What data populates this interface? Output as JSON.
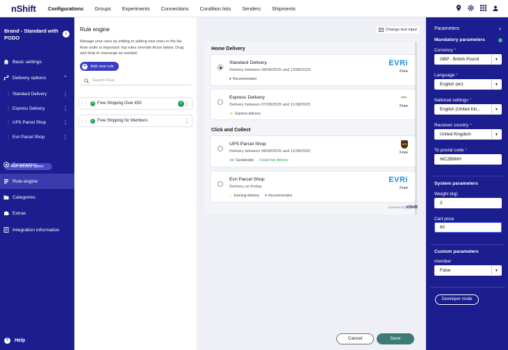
{
  "app": {
    "logo": "nShift",
    "nav": [
      "Configurations",
      "Groups",
      "Experiments",
      "Connections",
      "Condition lists",
      "Senders",
      "Shipments"
    ],
    "nav_active": "Configurations"
  },
  "sidebar": {
    "brand": "Brand - Standard with PODO",
    "items": {
      "basic_settings": "Basic settings",
      "delivery_options": "Delivery options",
      "parameters": "Parameters",
      "rule_engine": "Rule engine",
      "categories": "Categories",
      "extras": "Extras",
      "integration": "Integration information"
    },
    "delivery_sub": [
      "Standard Delivery",
      "Express Delivery",
      "UPS Parcel Shop",
      "Evri Parcel Shop"
    ],
    "add_delivery_option": "Add delivery option",
    "help": "Help"
  },
  "rules": {
    "title": "Rule engine",
    "description": "Manage your rules by editing or adding new ones to the list. Rule order is important: top rules override those below. Drag and drop to rearrange as needed.",
    "add_rule": "Add new rule",
    "search_placeholder": "Search Rule",
    "list": [
      "Free Shipping Over £50",
      "Free Shipping for Members"
    ]
  },
  "preview": {
    "change_test_input": "Change test input",
    "home_delivery": "Home Delivery",
    "click_collect": "Click and Collect",
    "options": [
      {
        "name": "Standard Delivery",
        "sub": "Delivery between 08/08/2025 and 12/08/2025",
        "price": "Free",
        "carrier": "EVRi",
        "tag1": "Recommended",
        "tag2": ""
      },
      {
        "name": "Express Delivery",
        "sub": "Delivery between 07/08/2025 and 11/08/2025",
        "price": "Free",
        "carrier": "",
        "tag1": "Express delivery",
        "tag2": ""
      },
      {
        "name": "UPS Parcel Shop",
        "sub": "Delivery between 08/08/2025 and 11/08/2025",
        "price": "Free",
        "carrier": "UPS",
        "tag1": "Sustainable",
        "tag2": "Fossil free delivery"
      },
      {
        "name": "Evri Parcel Shop",
        "sub": "Delivery on Friday",
        "price": "Free",
        "carrier": "EVRi",
        "tag1": "Evening delivery",
        "tag2": "Recommended"
      }
    ],
    "powered_by": "powered by",
    "powered_brand": "nShift",
    "cancel": "Cancel",
    "save": "Save"
  },
  "params": {
    "title": "Parameters",
    "mandatory": "Mandatory parameters",
    "currency_label": "Currency",
    "currency": "GBP - British Pound",
    "language_label": "Language",
    "language": "English (en)",
    "national_label": "National settings",
    "national": "English (United Kin...",
    "receiver_label": "Receiver country",
    "receiver": "United Kingdom",
    "postal_label": "To postal code",
    "postal": "WC2B6NH",
    "system": "System parameters",
    "weight_label": "Weight (kg)",
    "weight": "2",
    "cart_label": "Cart price",
    "cart": "60",
    "custom": "Custom parameters",
    "member_label": "member",
    "member": "False",
    "developer": "Developer mode"
  }
}
